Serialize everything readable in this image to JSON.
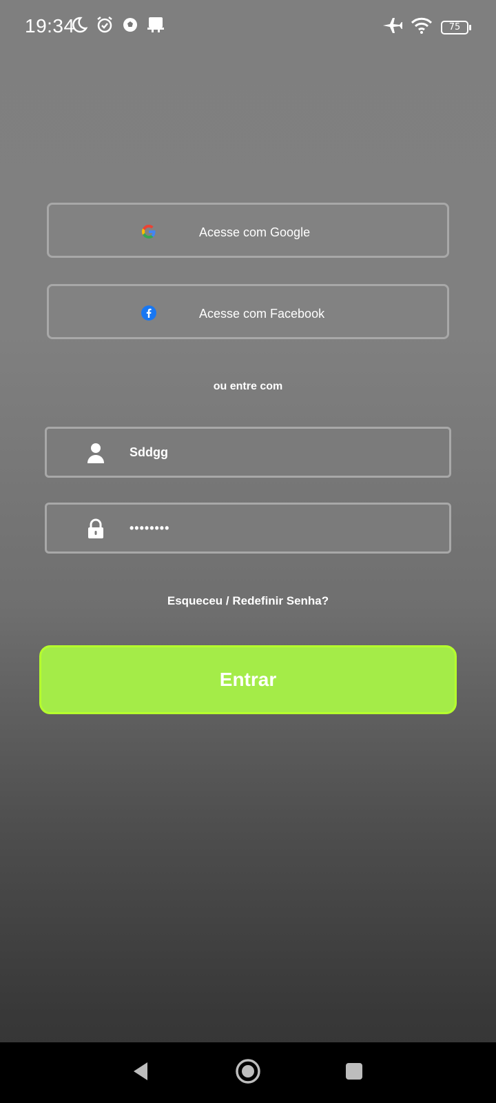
{
  "status_bar": {
    "time": "19:34",
    "battery": "75"
  },
  "social": {
    "google_label": "Acesse com Google",
    "facebook_label": "Acesse com Facebook"
  },
  "divider_text": "ou entre com",
  "form": {
    "username_value": "Sddgg",
    "password_value": "12345678"
  },
  "forgot_password_label": "Esqueceu / Redefinir Senha?",
  "submit_label": "Entrar",
  "colors": {
    "accent": "#a4ec48",
    "accent_border": "#b6ff2d",
    "facebook": "#1877f2"
  }
}
